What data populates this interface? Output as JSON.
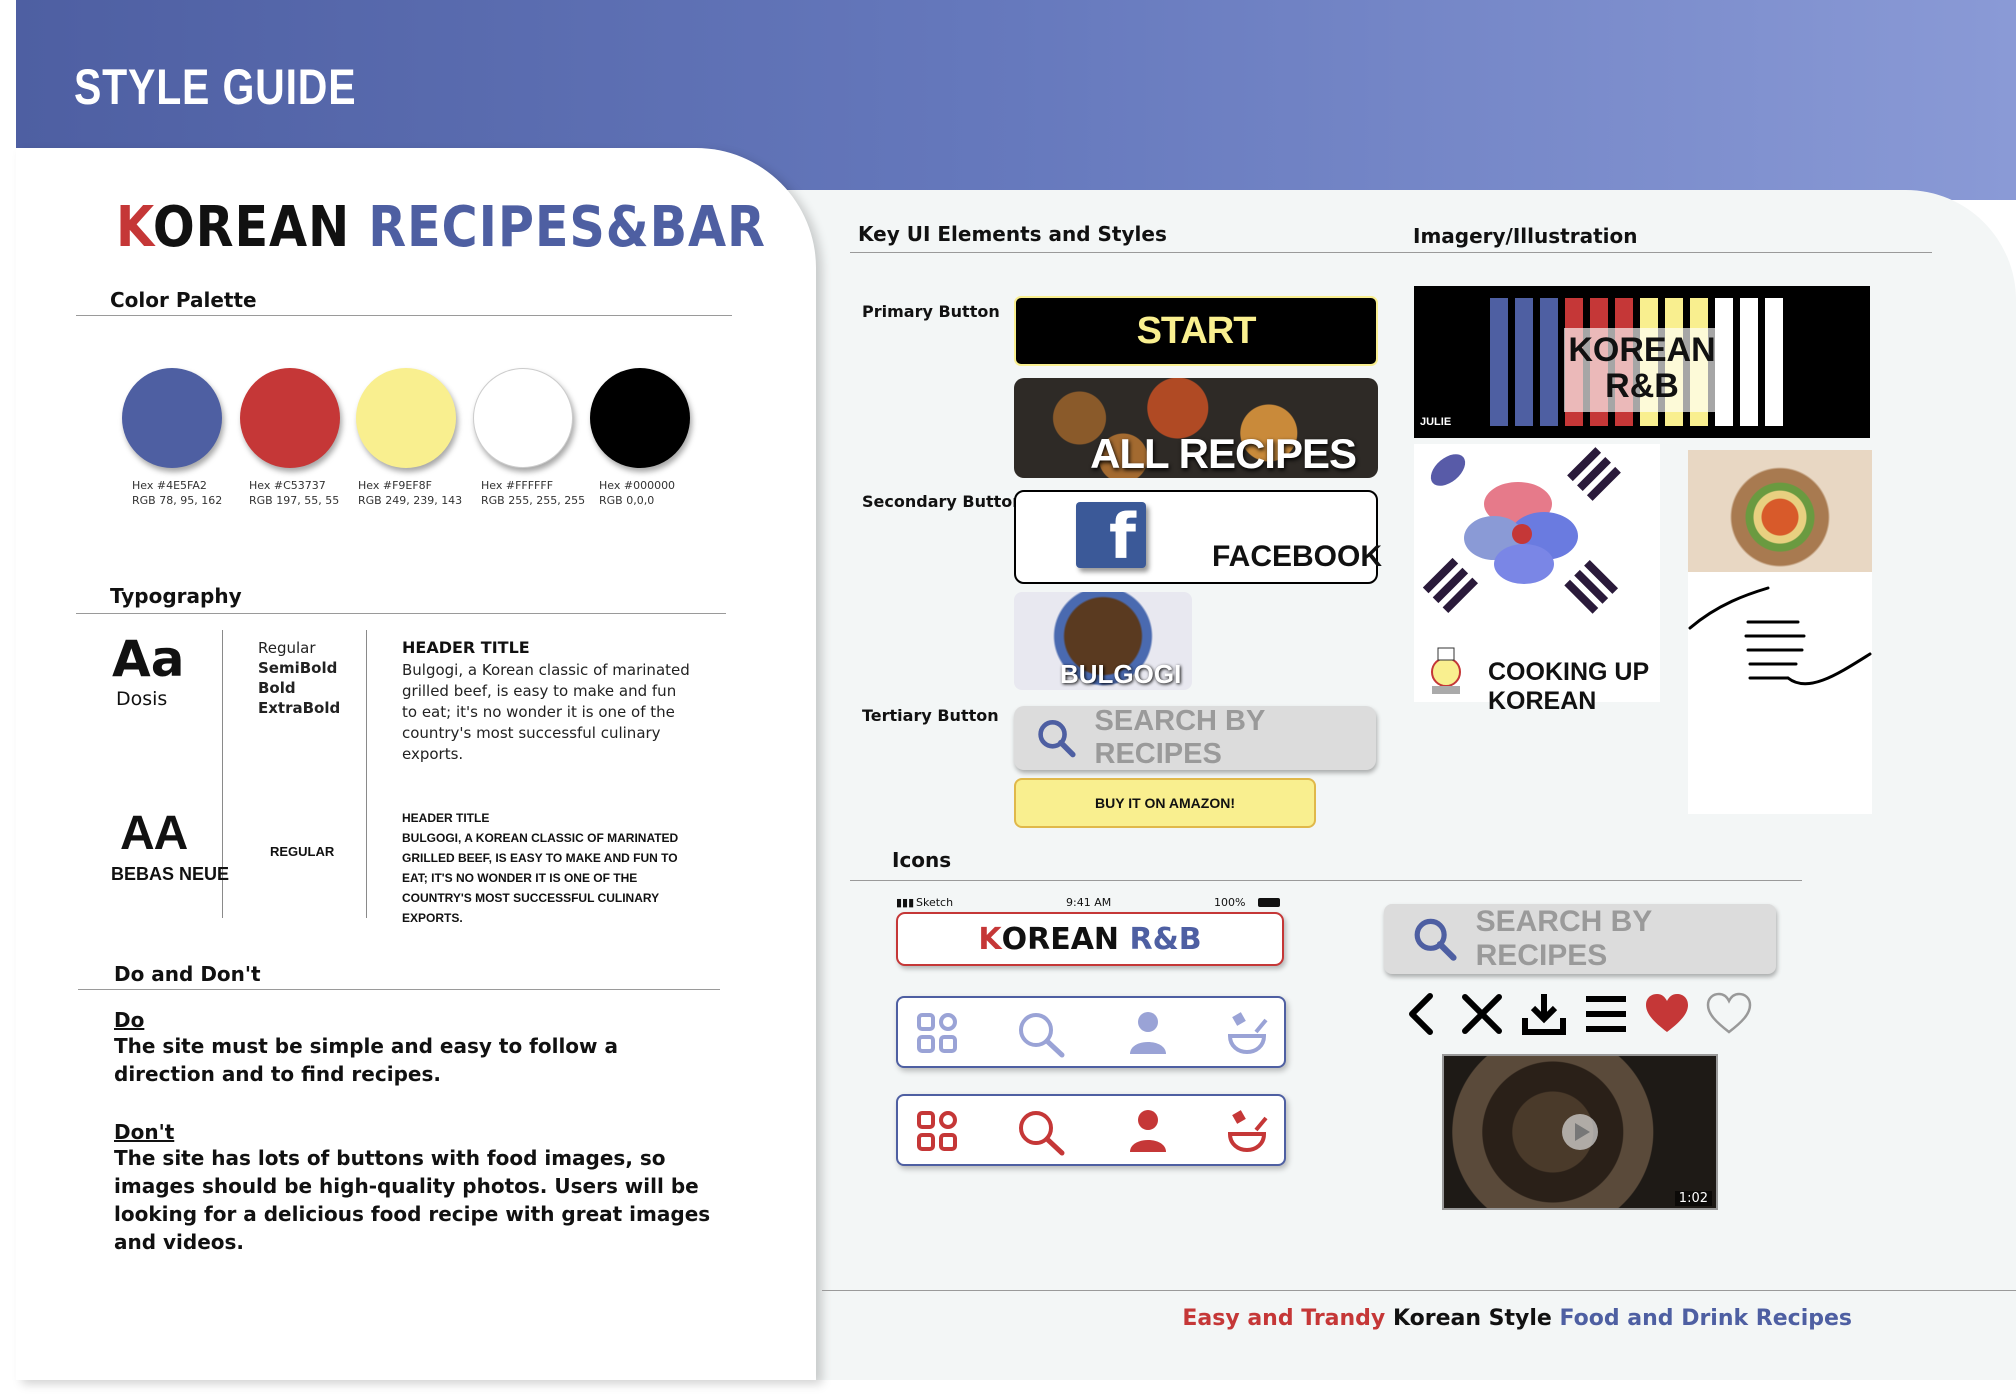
{
  "header": {
    "title": "STYLE GUIDE"
  },
  "brand": {
    "k": "K",
    "orean": "OREAN",
    "recipes": "RECIPES&BAR"
  },
  "palette": {
    "heading": "Color Palette",
    "swatches": [
      {
        "color": "#4e5fa2",
        "hex": "Hex #4E5FA2",
        "rgb": "RGB 78, 95, 162"
      },
      {
        "color": "#c53737",
        "hex": "Hex #C53737",
        "rgb": "RGB 197, 55, 55"
      },
      {
        "color": "#f9ef8f",
        "hex": "Hex #F9EF8F",
        "rgb": "RGB 249, 239, 143"
      },
      {
        "color": "#ffffff",
        "hex": "Hex #FFFFFF",
        "rgb": "RGB 255, 255, 255"
      },
      {
        "color": "#000000",
        "hex": "Hex #000000",
        "rgb": "RGB  0,0,0"
      }
    ]
  },
  "typography": {
    "heading": "Typography",
    "dosis": {
      "sample": "Aa",
      "name": "Dosis",
      "weights": [
        "Regular",
        "SemiBold",
        "Bold",
        "ExtraBold"
      ],
      "header": "HEADER TITLE",
      "body": "Bulgogi, a Korean classic of marinated grilled beef, is easy to make and fun to eat; it's no wonder it is one of the country's most successful culinary exports."
    },
    "bebas": {
      "sample": "AA",
      "name": "BEBAS NEUE",
      "weight": "REGULAR",
      "header": "HEADER TITLE",
      "body": "BULGOGI, A KOREAN CLASSIC OF MARINATED GRILLED BEEF, IS EASY TO MAKE AND FUN TO EAT; IT'S NO WONDER IT IS ONE OF THE COUNTRY'S MOST SUCCESSFUL CULINARY EXPORTS."
    }
  },
  "dodont": {
    "heading": "Do and Don't",
    "do_label": "Do",
    "do_text": "The site must be simple and easy to follow a direction and to find recipes.",
    "dont_label": "Don't",
    "dont_text": "The site has lots of buttons with food images, so images should be high-quality photos. Users will be looking for a delicious food recipe with great images and videos."
  },
  "ui": {
    "heading": "Key UI Elements and Styles",
    "primary_label": "Primary Button",
    "secondary_label": "Secondary Button",
    "tertiary_label": "Tertiary Button",
    "start": "START",
    "all_recipes": "ALL RECIPES",
    "facebook": "FACEBOOK",
    "bulgogi": "BULGOGI",
    "search": "SEARCH BY RECIPES",
    "amazon": "BUY IT ON AMAZON!"
  },
  "imagery": {
    "heading": "Imagery/Illustration",
    "logo_line1": "KOREAN",
    "logo_line2": "R&B",
    "julie": "JULIE",
    "cooking": "COOKING UP KOREAN"
  },
  "icons": {
    "heading": "Icons",
    "status_left": "Sketch",
    "status_time": "9:41 AM",
    "status_batt": "100%",
    "app_k": "K",
    "app_orean": "OREAN",
    "app_rb": "R&B",
    "search": "SEARCH BY RECIPES",
    "video_time": "1:02"
  },
  "footer": {
    "part1": "Easy and Trandy",
    "part2": "Korean Style",
    "part3": "Food and Drink Recipes"
  }
}
